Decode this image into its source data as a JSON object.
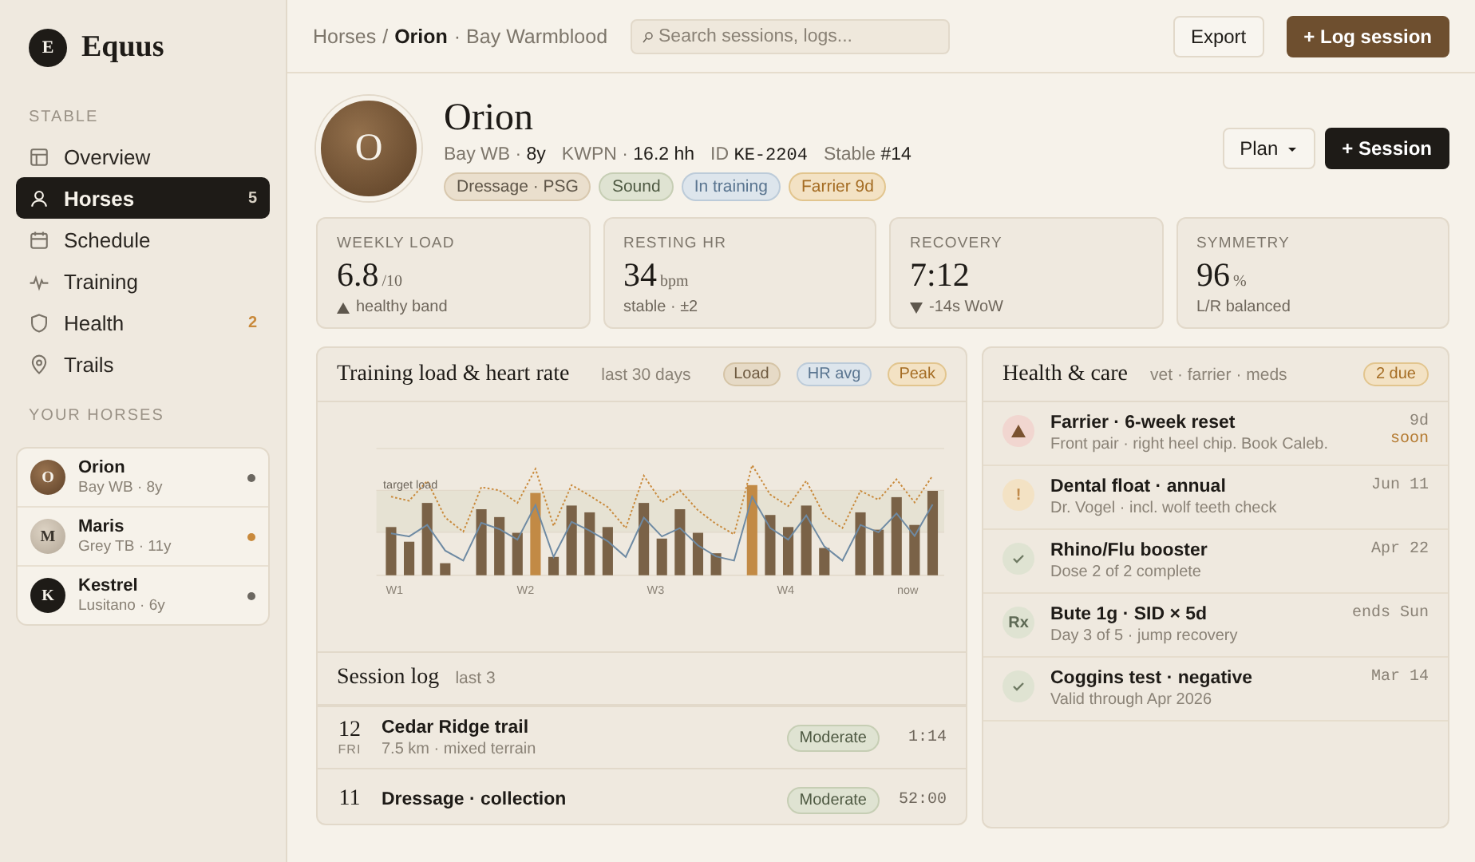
{
  "brand": {
    "initial": "E",
    "name": "Equus"
  },
  "sidebar": {
    "section_title": "STABLE",
    "items": [
      {
        "kind": "grid",
        "label": "Overview",
        "selected": false
      },
      {
        "kind": "person",
        "label": "Horses",
        "selected": true,
        "badge": {
          "text": "5",
          "alert": false
        }
      },
      {
        "kind": "calendar",
        "label": "Schedule",
        "selected": false
      },
      {
        "kind": "pulse",
        "label": "Training",
        "selected": false
      },
      {
        "kind": "shield",
        "label": "Health",
        "selected": false,
        "badge": {
          "text": "2",
          "alert": true
        }
      },
      {
        "kind": "pin",
        "label": "Trails",
        "selected": false
      }
    ],
    "horses_title": "YOUR HORSES",
    "horses": [
      {
        "initial": "O",
        "name": "Orion",
        "meta": "Bay WB · 8y",
        "kind": "bay",
        "color": "#6b6760"
      },
      {
        "initial": "M",
        "name": "Maris",
        "meta": "Grey TB · 11y",
        "kind": "grey",
        "color": "#c98a3c"
      },
      {
        "initial": "K",
        "name": "Kestrel",
        "meta": "Lusitano · 6y",
        "kind": "black",
        "color": "#6b6760"
      }
    ]
  },
  "topbar": {
    "breadcrumb": [
      {
        "text": "Horses",
        "current": false
      },
      {
        "text": "Orion",
        "current": true
      }
    ],
    "separator": "/",
    "suffix": "· Bay Warmblood",
    "search": {
      "placeholder": "Search sessions, logs..."
    },
    "buttons": [
      {
        "label": "Export",
        "kind": "secondary"
      },
      {
        "label": "+ Log session",
        "kind": "primary"
      }
    ]
  },
  "profile": {
    "initial": "O",
    "name": "Orion",
    "meta": [
      {
        "label": "Bay WB ·",
        "value": "8y",
        "mono": false
      },
      {
        "label": "KWPN ·",
        "value": "16.2 hh",
        "mono": false
      },
      {
        "label": "ID",
        "value": "KE-2204",
        "mono": true
      },
      {
        "label": "Stable",
        "value": "#14",
        "mono": false
      }
    ],
    "tags": [
      {
        "text": "Dressage · PSG",
        "kind": "neutral"
      },
      {
        "text": "Sound",
        "kind": "green"
      },
      {
        "text": "In training",
        "kind": "blue"
      },
      {
        "text": "Farrier 9d",
        "kind": "amber"
      }
    ],
    "buttons": [
      {
        "label": "Plan",
        "kind": "menu"
      },
      {
        "label": "+ Session",
        "kind": "dark"
      }
    ]
  },
  "stats": [
    {
      "label": "WEEKLY LOAD",
      "value": "6.8",
      "unit": "/10",
      "note": "healthy band",
      "kind": "up"
    },
    {
      "label": "RESTING HR",
      "value": "34",
      "unit": "bpm",
      "note": "stable · ±2",
      "kind": "flat"
    },
    {
      "label": "RECOVERY",
      "value": "7:12",
      "note": "-14s WoW",
      "kind": "down"
    },
    {
      "label": "SYMMETRY",
      "value": "96",
      "unit": "%",
      "note": "L/R balanced",
      "kind": "flat"
    }
  ],
  "training": {
    "title": "Training load & heart rate",
    "subtitle": "last 30 days",
    "legend": [
      {
        "text": "Load",
        "kind": "load"
      },
      {
        "text": "HR avg",
        "kind": "hr"
      },
      {
        "text": "Peak",
        "kind": "peak"
      }
    ],
    "band_label": "target load",
    "x_labels": [
      "W1",
      "W2",
      "W3",
      "W4",
      "now"
    ]
  },
  "session_log": {
    "title": "Session log",
    "subtitle": "last 3",
    "rows": [
      {
        "day": "12",
        "weekday": "FRI",
        "title": "Cedar Ridge trail",
        "sub": "7.5 km · mixed terrain",
        "intensity": "Moderate",
        "duration": "1:14"
      },
      {
        "day": "11",
        "title": "Dressage · collection",
        "intensity": "Moderate",
        "duration": "52:00"
      }
    ]
  },
  "health": {
    "title": "Health & care",
    "subtitle": "vet · farrier · meds",
    "badge": "2 due",
    "items": [
      {
        "kind": "warning",
        "title": "Farrier · 6-week reset",
        "sub": "Front pair · right heel chip. Book Caleb.",
        "date": "9d",
        "date_note": "soon"
      },
      {
        "kind": "alert",
        "icon_text": "!",
        "title": "Dental float · annual",
        "sub": "Dr. Vogel · incl. wolf teeth check",
        "date": "Jun 11"
      },
      {
        "kind": "done",
        "title": "Rhino/Flu booster",
        "sub": "Dose 2 of 2 complete",
        "date": "Apr 22"
      },
      {
        "kind": "med",
        "icon_text": "Rx",
        "title": "Bute 1g · SID × 5d",
        "sub": "Day 3 of 5 · jump recovery",
        "date": "ends Sun"
      },
      {
        "kind": "done",
        "title": "Coggins test · negative",
        "sub": "Valid through Apr 2026",
        "date": "Mar 14"
      }
    ]
  }
}
